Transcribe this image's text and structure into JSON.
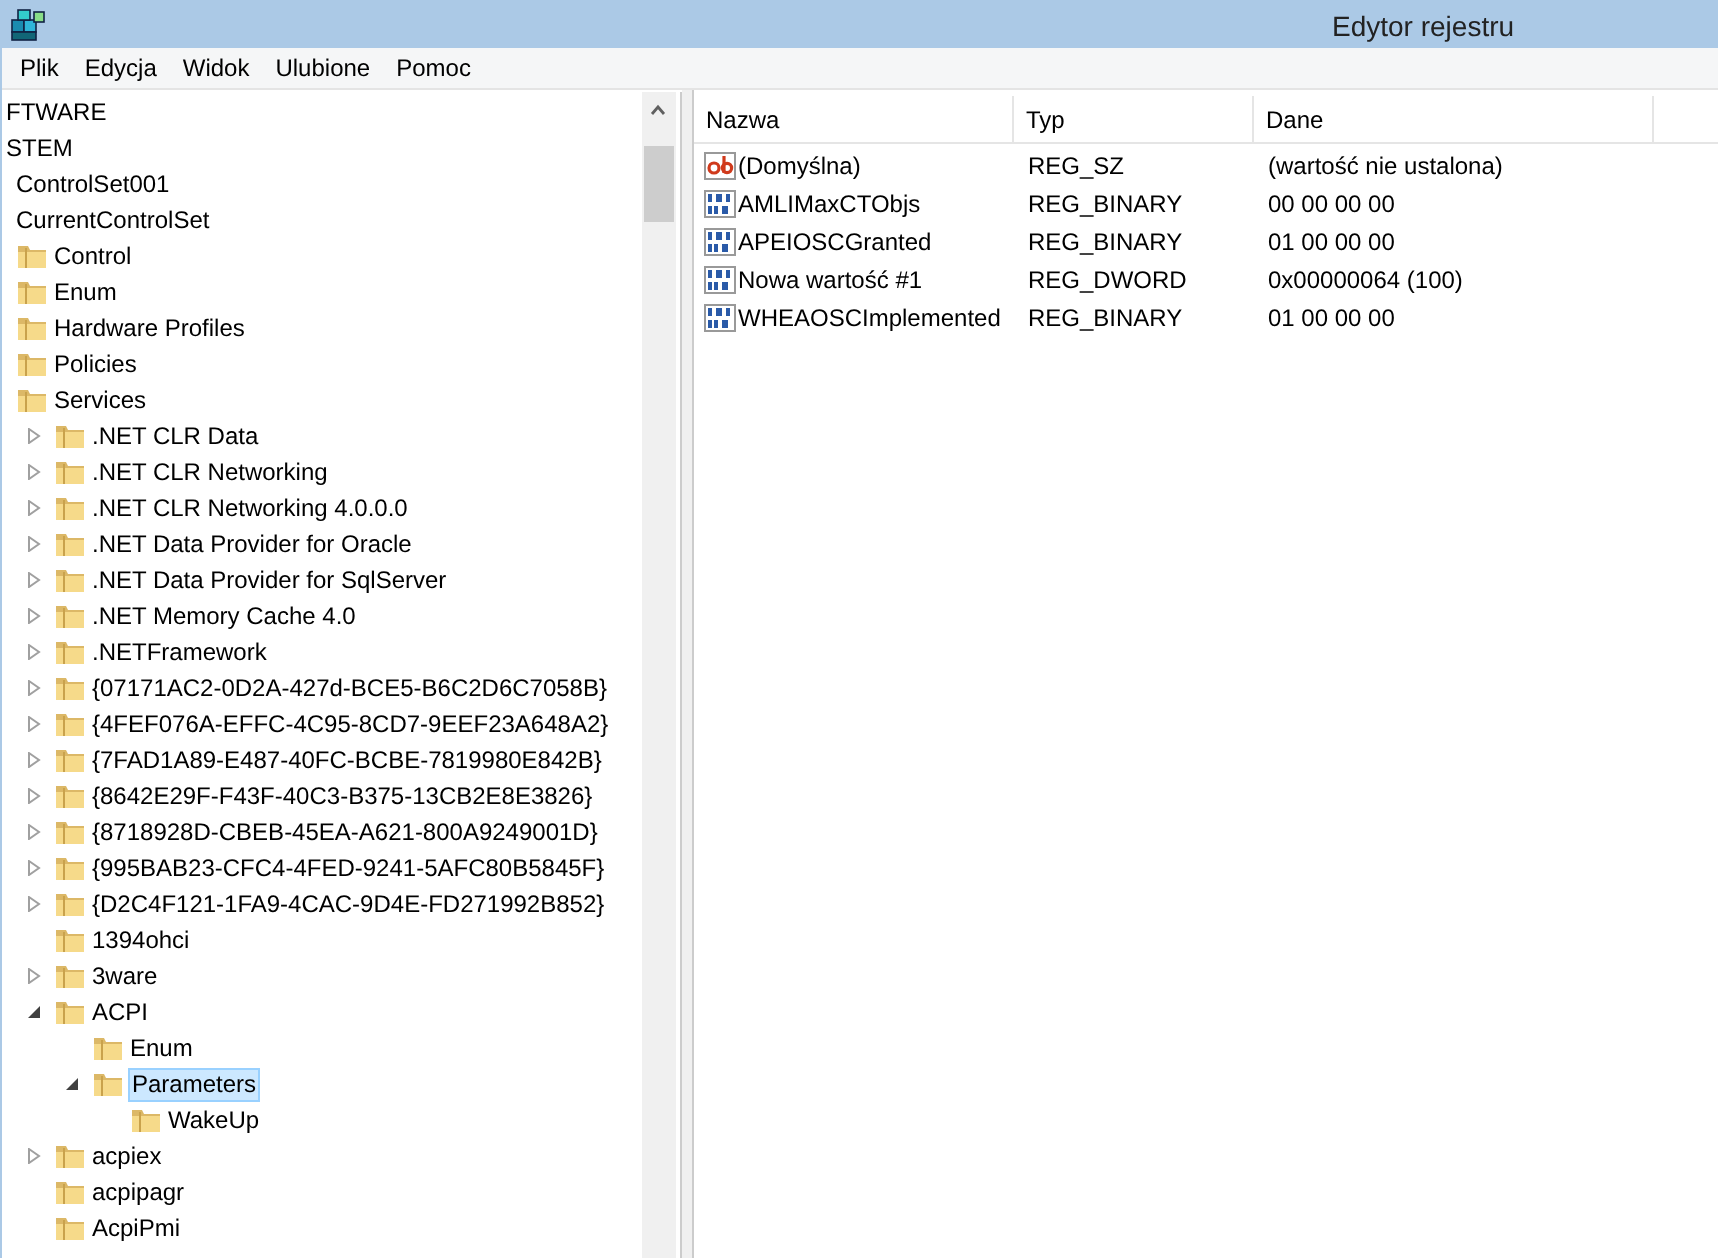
{
  "window": {
    "title": "Edytor rejestru"
  },
  "menu": [
    "Plik",
    "Edycja",
    "Widok",
    "Ulubione",
    "Pomoc"
  ],
  "tree": [
    {
      "label": "FTWARE",
      "selected": false
    },
    {
      "label": "STEM",
      "selected": false,
      "children": [
        {
          "label": "ControlSet001",
          "selected": false
        },
        {
          "label": "CurrentControlSet",
          "selected": false,
          "children": [
            {
              "label": "Control",
              "selected": false
            },
            {
              "label": "Enum",
              "selected": false
            },
            {
              "label": "Hardware Profiles",
              "selected": false
            },
            {
              "label": "Policies",
              "selected": false
            },
            {
              "label": "Services",
              "selected": false,
              "children": [
                {
                  "label": ".NET CLR Data",
                  "selected": false,
                  "expanded": false
                },
                {
                  "label": ".NET CLR Networking",
                  "selected": false,
                  "expanded": false
                },
                {
                  "label": ".NET CLR Networking 4.0.0.0",
                  "selected": false,
                  "expanded": false
                },
                {
                  "label": ".NET Data Provider for Oracle",
                  "selected": false,
                  "expanded": false
                },
                {
                  "label": ".NET Data Provider for SqlServer",
                  "selected": false,
                  "expanded": false
                },
                {
                  "label": ".NET Memory Cache 4.0",
                  "selected": false,
                  "expanded": false
                },
                {
                  "label": ".NETFramework",
                  "selected": false,
                  "expanded": false
                },
                {
                  "label": "{07171AC2-0D2A-427d-BCE5-B6C2D6C7058B}",
                  "selected": false,
                  "expanded": false
                },
                {
                  "label": "{4FEF076A-EFFC-4C95-8CD7-9EEF23A648A2}",
                  "selected": false,
                  "expanded": false
                },
                {
                  "label": "{7FAD1A89-E487-40FC-BCBE-7819980E842B}",
                  "selected": false,
                  "expanded": false
                },
                {
                  "label": "{8642E29F-F43F-40C3-B375-13CB2E8E3826}",
                  "selected": false,
                  "expanded": false
                },
                {
                  "label": "{8718928D-CBEB-45EA-A621-800A9249001D}",
                  "selected": false,
                  "expanded": false
                },
                {
                  "label": "{995BAB23-CFC4-4FED-9241-5AFC80B5845F}",
                  "selected": false,
                  "expanded": false
                },
                {
                  "label": "{D2C4F121-1FA9-4CAC-9D4E-FD271992B852}",
                  "selected": false,
                  "expanded": false
                },
                {
                  "label": "1394ohci",
                  "selected": false
                },
                {
                  "label": "3ware",
                  "selected": false,
                  "expanded": false
                },
                {
                  "label": "ACPI",
                  "selected": false,
                  "expanded": true,
                  "children": [
                    {
                      "label": "Enum",
                      "selected": false
                    },
                    {
                      "label": "Parameters",
                      "selected": true,
                      "expanded": true,
                      "children": [
                        {
                          "label": "WakeUp",
                          "selected": false
                        }
                      ]
                    }
                  ]
                },
                {
                  "label": "acpiex",
                  "selected": false,
                  "expanded": false
                },
                {
                  "label": "acpipagr",
                  "selected": false
                },
                {
                  "label": "AcpiPmi",
                  "selected": false
                }
              ]
            }
          ]
        }
      ]
    }
  ],
  "table": {
    "columns": [
      "Nazwa",
      "Typ",
      "Dane"
    ],
    "rows": [
      {
        "kind": "string",
        "name": "(Domyślna)",
        "type": "REG_SZ",
        "data": "(wartość nie ustalona)"
      },
      {
        "kind": "binary",
        "name": "AMLIMaxCTObjs",
        "type": "REG_BINARY",
        "data": "00 00 00 00"
      },
      {
        "kind": "binary",
        "name": "APEIOSCGranted",
        "type": "REG_BINARY",
        "data": "01 00 00 00"
      },
      {
        "kind": "binary",
        "name": "Nowa wartość #1",
        "type": "REG_DWORD",
        "data": "0x00000064 (100)"
      },
      {
        "kind": "binary",
        "name": "WHEAOSCImplemented",
        "type": "REG_BINARY",
        "data": "01 00 00 00"
      }
    ]
  }
}
